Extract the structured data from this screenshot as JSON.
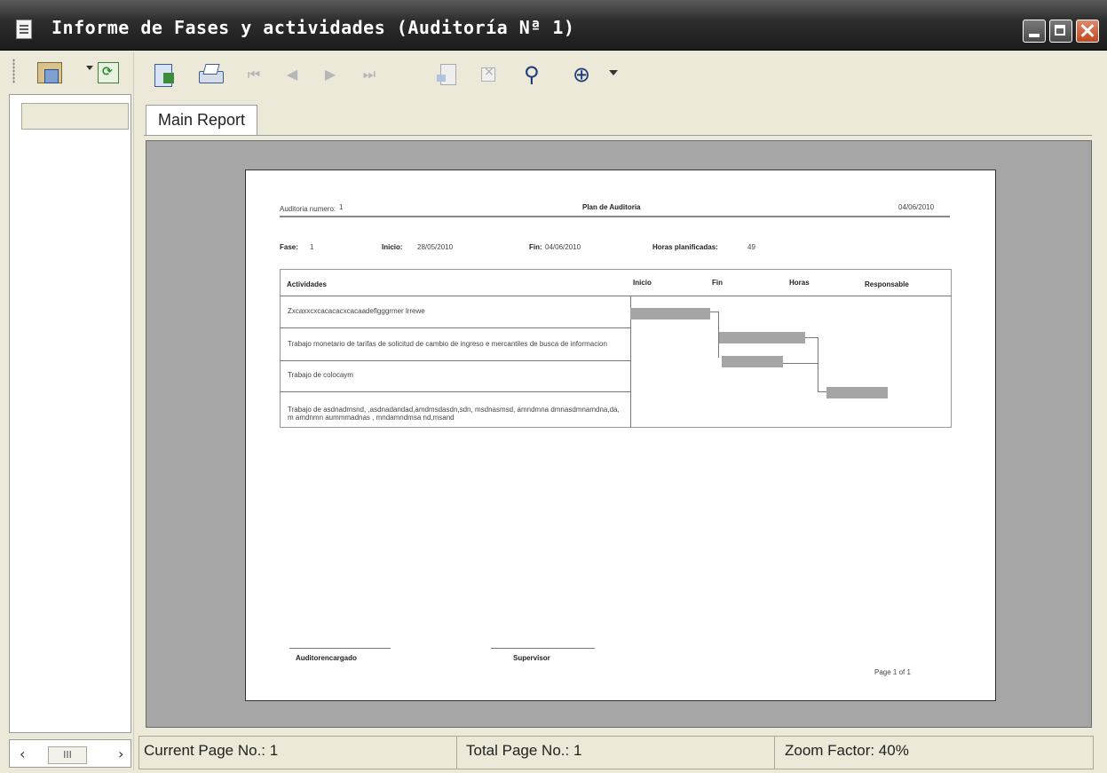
{
  "window": {
    "title": "Informe de Fases y actividades (Auditoría Nª 1)"
  },
  "left_panel": {
    "hscroll_grip": "III"
  },
  "toolbar": {
    "buttons": [
      "export-icon",
      "print-icon",
      "first-page-icon",
      "previous-page-icon",
      "next-page-icon",
      "last-page-icon",
      "goto-page-icon",
      "stop-icon",
      "search-icon",
      "zoom-icon"
    ]
  },
  "tabs": [
    {
      "label": "Main Report"
    }
  ],
  "report": {
    "header": {
      "auditoria_label": "Auditoria numero:",
      "auditoria_value": "1",
      "title": "Plan de Auditoria",
      "date": "04/06/2010"
    },
    "fase": {
      "fase_label": "Fase:",
      "fase_value": "1",
      "inicio_label": "Inicio:",
      "inicio_value": "28/05/2010",
      "fin_label": "Fin:",
      "fin_value": "04/06/2010",
      "horas_label": "Horas planificadas:",
      "horas_value": "49"
    },
    "table": {
      "columns": [
        "Actividades",
        "Inicio",
        "Fin",
        "Horas",
        "Responsable"
      ],
      "rows": [
        {
          "actividad": "Zxcaxxcxcacacacxcacaadeflgggrmer lrrewe"
        },
        {
          "actividad": "Trabajo monetario de tarifas de solicitud de cambio de ingreso e mercantiles de busca de informacion"
        },
        {
          "actividad": "Trabajo de colocaym"
        },
        {
          "actividad": "Trabajo de asdnadmsnd, ,asdnadandad,amdmsdasdn,sdn, msdnasmsd, amndmna dmnasdmnamdna,da, m amdnmn aummmadnas , mndamndmsa nd,msand"
        }
      ]
    },
    "footer": {
      "signature_left": "Auditorencargado",
      "signature_right": "Supervisor",
      "page": "Page 1 of 1"
    }
  },
  "status": {
    "current_page": "Current Page No.: 1",
    "total_page": "Total Page No.: 1",
    "zoom": "Zoom Factor: 40%"
  },
  "colors": {
    "titlebar": "#2e2e2e",
    "report_bg": "#a6a6a6",
    "gantt_bar": "#a5a5a5"
  }
}
